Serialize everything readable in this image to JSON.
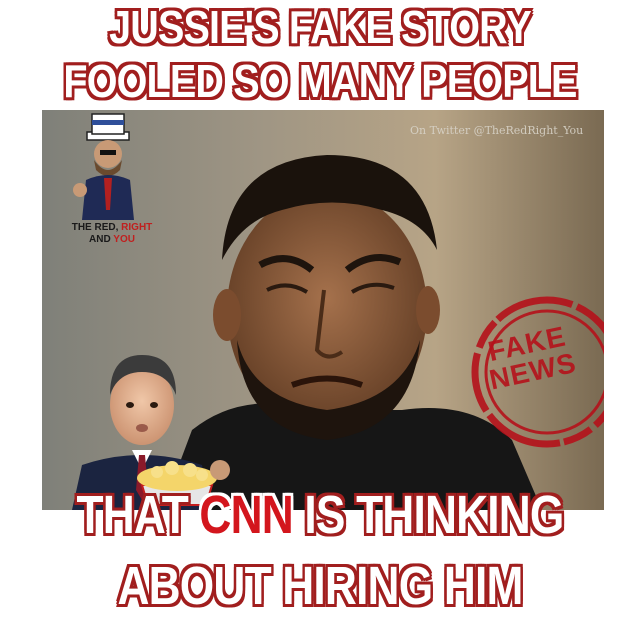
{
  "headline": {
    "line1": "JUSSIE'S FAKE STORY",
    "line2": "FOOLED SO MANY PEOPLE"
  },
  "watermark": "On Twitter @TheRedRight_You",
  "logo": {
    "line1_black": "THE RED, ",
    "line1_red": "RIGHT",
    "line2_black": "AND ",
    "line2_red": "YOU"
  },
  "stamp": {
    "line1": "FAKE",
    "line2": "NEWS"
  },
  "caption": {
    "line1_before": "THAT ",
    "line1_highlight": "CNN",
    "line1_after": " IS THINKING",
    "line2": "ABOUT HIRING HIM"
  },
  "colors": {
    "text_fill": "#ffffff",
    "text_outline": "#a11e1e",
    "cnn_red": "#d3161d",
    "stamp_red": "#b5121b"
  }
}
